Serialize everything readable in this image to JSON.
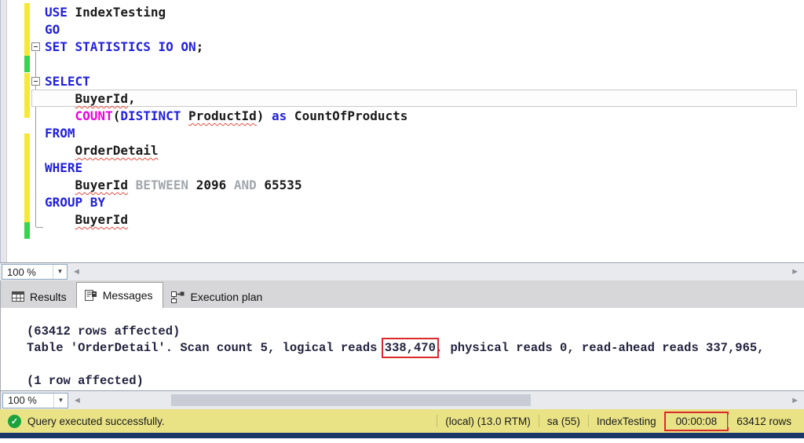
{
  "editor": {
    "zoom_value": "100 %",
    "code_lines": [
      {
        "tokens": [
          {
            "t": "USE ",
            "c": "kw"
          },
          {
            "t": "IndexTesting",
            "c": "pl"
          }
        ]
      },
      {
        "tokens": [
          {
            "t": "GO",
            "c": "kw"
          }
        ]
      },
      {
        "fold": "collapse-minus",
        "tokens": [
          {
            "t": "SET STATISTICS IO ON",
            "c": "kw"
          },
          {
            "t": ";",
            "c": "pl"
          }
        ]
      },
      {
        "tokens": []
      },
      {
        "fold": "collapse-minus",
        "tokens": [
          {
            "t": "SELECT",
            "c": "kw"
          }
        ]
      },
      {
        "current": true,
        "tokens": [
          {
            "t": "    ",
            "c": "pl"
          },
          {
            "t": "BuyerId",
            "c": "pl",
            "u": true
          },
          {
            "t": ",",
            "c": "pl"
          }
        ]
      },
      {
        "tokens": [
          {
            "t": "    ",
            "c": "pl"
          },
          {
            "t": "COUNT",
            "c": "fn"
          },
          {
            "t": "(",
            "c": "pl"
          },
          {
            "t": "DISTINCT",
            "c": "kw"
          },
          {
            "t": " ",
            "c": "pl"
          },
          {
            "t": "ProductId",
            "c": "pl",
            "u": true
          },
          {
            "t": ")",
            "c": "pl"
          },
          {
            "t": " ",
            "c": "pl"
          },
          {
            "t": "as",
            "c": "kw"
          },
          {
            "t": " CountOfProducts",
            "c": "pl"
          }
        ]
      },
      {
        "tokens": [
          {
            "t": "FROM",
            "c": "kw"
          }
        ]
      },
      {
        "tokens": [
          {
            "t": "    ",
            "c": "pl"
          },
          {
            "t": "OrderDetail",
            "c": "pl",
            "u": true
          }
        ]
      },
      {
        "tokens": [
          {
            "t": "WHERE",
            "c": "kw"
          }
        ]
      },
      {
        "tokens": [
          {
            "t": "    ",
            "c": "pl"
          },
          {
            "t": "BuyerId",
            "c": "pl",
            "u": true
          },
          {
            "t": " ",
            "c": "pl"
          },
          {
            "t": "BETWEEN",
            "c": "op"
          },
          {
            "t": " ",
            "c": "pl"
          },
          {
            "t": "2096",
            "c": "pl"
          },
          {
            "t": " ",
            "c": "pl"
          },
          {
            "t": "AND",
            "c": "op"
          },
          {
            "t": " ",
            "c": "pl"
          },
          {
            "t": "65535",
            "c": "pl"
          }
        ]
      },
      {
        "tokens": [
          {
            "t": "GROUP BY",
            "c": "kw"
          }
        ]
      },
      {
        "tokens": [
          {
            "t": "    ",
            "c": "pl"
          },
          {
            "t": "BuyerId",
            "c": "pl",
            "u": true
          }
        ]
      }
    ]
  },
  "results_panel": {
    "zoom_value": "100 %",
    "tabs": [
      {
        "label": "Results",
        "icon": "results-grid-icon",
        "active": false
      },
      {
        "label": "Messages",
        "icon": "messages-icon",
        "active": true
      },
      {
        "label": "Execution plan",
        "icon": "execution-plan-icon",
        "active": false
      }
    ],
    "messages": [
      {
        "segments": [
          {
            "t": "(63412 rows affected)"
          }
        ]
      },
      {
        "segments": [
          {
            "t": "Table 'OrderDetail'. Scan count 5, logical reads "
          },
          {
            "t": "338,470",
            "boxed": true
          },
          {
            "t": ", physical reads 0, read-ahead reads 337,965,"
          }
        ]
      },
      {
        "segments": [
          {
            "t": ""
          }
        ]
      },
      {
        "segments": [
          {
            "t": "(1 row affected)"
          }
        ]
      }
    ]
  },
  "status_bar": {
    "status_icon": "success-check-icon",
    "status_text": "Query executed successfully.",
    "items": [
      {
        "label": "(local) (13.0 RTM)"
      },
      {
        "label": "sa (55)"
      },
      {
        "label": "IndexTesting"
      },
      {
        "label": "00:00:08",
        "boxed": true
      },
      {
        "label": "63412 rows"
      }
    ]
  },
  "colors": {
    "keyword": "#2121dd",
    "function": "#ee00e2",
    "operator": "#a2a7ad",
    "plain": "#1a1a1a",
    "annotation": "#dc2a2a",
    "status_bg": "#e9e386",
    "status_ok": "#1ba23c",
    "dark_bar": "#1c3767",
    "change_yellow": "#f6e836",
    "change_green": "#38d450"
  }
}
